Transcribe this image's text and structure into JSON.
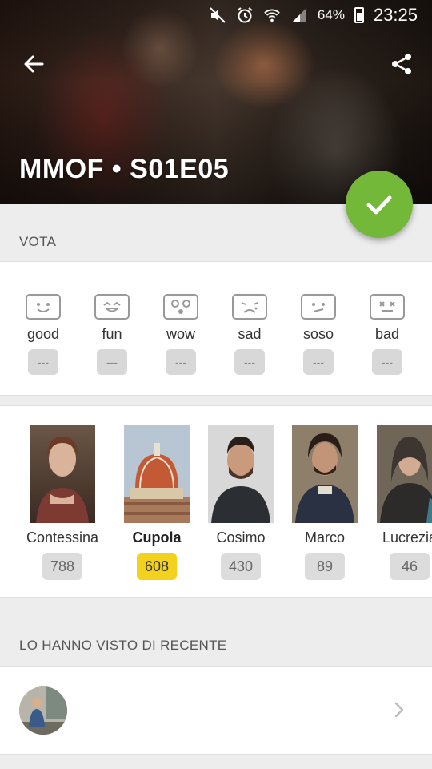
{
  "status": {
    "battery": "64%",
    "time": "23:25"
  },
  "header": {
    "title": "MMOF • S01E05"
  },
  "vote_section": {
    "label": "VOTA",
    "options": [
      {
        "label": "good",
        "count": "---",
        "icon": "smile-face-icon"
      },
      {
        "label": "fun",
        "count": "---",
        "icon": "laugh-face-icon"
      },
      {
        "label": "wow",
        "count": "---",
        "icon": "wow-face-icon"
      },
      {
        "label": "sad",
        "count": "---",
        "icon": "sad-face-icon"
      },
      {
        "label": "soso",
        "count": "---",
        "icon": "meh-face-icon"
      },
      {
        "label": "bad",
        "count": "---",
        "icon": "dead-face-icon"
      }
    ]
  },
  "characters": [
    {
      "name": "Contessina",
      "count": "788",
      "highlighted": false
    },
    {
      "name": "Cupola",
      "count": "608",
      "highlighted": true
    },
    {
      "name": "Cosimo",
      "count": "430",
      "highlighted": false
    },
    {
      "name": "Marco",
      "count": "89",
      "highlighted": false
    },
    {
      "name": "Lucrezia",
      "count": "46",
      "highlighted": false
    }
  ],
  "recent_section": {
    "label": "LO HANNO VISTO DI RECENTE"
  },
  "colors": {
    "accent_green": "#74b83a",
    "highlight_yellow": "#f2d21c"
  }
}
